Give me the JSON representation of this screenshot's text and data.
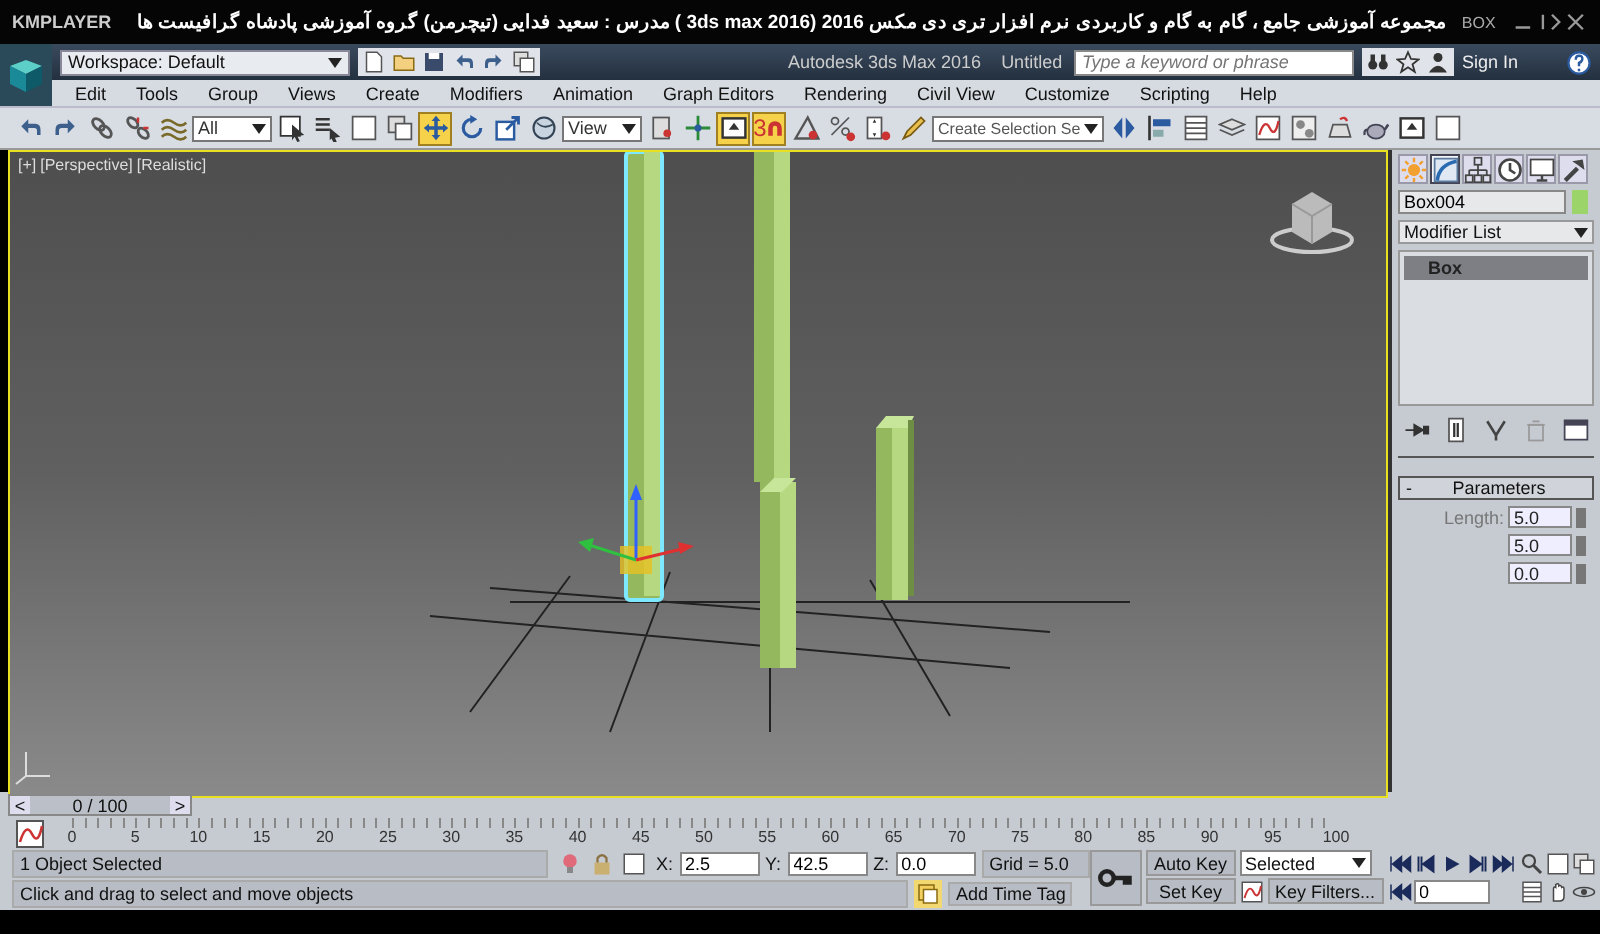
{
  "player_bar": {
    "name": "KMPLAYER",
    "title": "مجموعه آموزشی جامع ، گام به گام و کاربردی نرم افزار تری دی مکس 2016 (3ds max 2016 )  مدرس : سعید فدایی (تیچرمن) گروه آموزشی پادشاه گرافیست ها",
    "label": "BOX"
  },
  "title_bar": {
    "workspace": "Workspace: Default",
    "title": "Autodesk 3ds Max 2016",
    "document": "Untitled",
    "search": {
      "placeholder": "Type a keyword or phrase"
    },
    "sign_in": "Sign In"
  },
  "menu": [
    "Edit",
    "Tools",
    "Group",
    "Views",
    "Create",
    "Modifiers",
    "Animation",
    "Graph Editors",
    "Rendering",
    "Civil View",
    "Customize",
    "Scripting",
    "Help"
  ],
  "main_toolbar": [
    {
      "kind": "button",
      "selected": false
    },
    {
      "kind": "button",
      "selected": false
    },
    {
      "kind": "button",
      "selected": false
    },
    {
      "kind": "button",
      "selected": false
    },
    {
      "kind": "button",
      "selected": false
    },
    {
      "kind": "dropdown",
      "value": "All"
    },
    {
      "kind": "button",
      "selected": false
    },
    {
      "kind": "button",
      "selected": false
    },
    {
      "kind": "button",
      "selected": false
    },
    {
      "kind": "button",
      "selected": false
    },
    {
      "kind": "button",
      "selected": true
    },
    {
      "kind": "button",
      "selected": false
    },
    {
      "kind": "button",
      "selected": false
    },
    {
      "kind": "button",
      "selected": false
    },
    {
      "kind": "dropdown",
      "value": "View"
    },
    {
      "kind": "button",
      "selected": false
    },
    {
      "kind": "button",
      "selected": false
    },
    {
      "kind": "button",
      "selected": true
    },
    {
      "kind": "button",
      "selected": true,
      "label": "3"
    },
    {
      "kind": "button",
      "selected": false
    },
    {
      "kind": "button",
      "selected": false
    },
    {
      "kind": "button",
      "selected": false
    },
    {
      "kind": "button",
      "selected": false
    },
    {
      "kind": "dropdown",
      "value": "Create Selection Se"
    },
    {
      "kind": "button",
      "selected": false
    },
    {
      "kind": "button",
      "selected": false
    },
    {
      "kind": "button",
      "selected": false
    },
    {
      "kind": "button",
      "selected": false
    },
    {
      "kind": "button",
      "selected": false
    },
    {
      "kind": "button",
      "selected": false
    },
    {
      "kind": "button",
      "selected": false
    },
    {
      "kind": "button",
      "selected": false
    },
    {
      "kind": "button",
      "selected": false
    },
    {
      "kind": "button",
      "selected": false
    }
  ],
  "viewport": {
    "labels": [
      "[+]",
      "[Perspective]",
      "[Realistic]"
    ]
  },
  "command_panel": {
    "tabs": [
      {
        "selected": false
      },
      {
        "selected": true
      },
      {
        "selected": false
      },
      {
        "selected": false
      },
      {
        "selected": false
      },
      {
        "selected": false
      }
    ],
    "object_name": "Box004",
    "modifier_list": "Modifier List",
    "stack": [
      {
        "label": "Box",
        "selected": true
      }
    ],
    "rollout": {
      "sign": "-",
      "title": "Parameters"
    },
    "params": [
      {
        "label": "Length:",
        "value": "5.0"
      },
      {
        "value": "5.0"
      },
      {
        "value": "0.0"
      }
    ]
  },
  "time_slider": {
    "label": "0 / 100",
    "level": 0,
    "prev": "<",
    "next": ">"
  },
  "track_bar": {
    "ticks": [
      "0",
      "5",
      "10",
      "15",
      "20",
      "25",
      "30",
      "35",
      "40",
      "45",
      "50",
      "55",
      "60",
      "65",
      "70",
      "75",
      "80",
      "85",
      "90",
      "95",
      "100"
    ]
  },
  "status": {
    "selection": "1 Object Selected",
    "prompt": "Click and drag to select and move objects",
    "x": {
      "label": "X:",
      "value": "2.5"
    },
    "y": {
      "label": "Y:",
      "value": "42.5"
    },
    "z": {
      "label": "Z:",
      "value": "0.0"
    },
    "grid": "Grid = 5.0",
    "time_tag": "Add Time Tag"
  },
  "animation": {
    "auto_key": "Auto Key",
    "set_key": "Set Key",
    "key_mode": "Selected",
    "key_filters": "Key Filters...",
    "frame": "0"
  }
}
